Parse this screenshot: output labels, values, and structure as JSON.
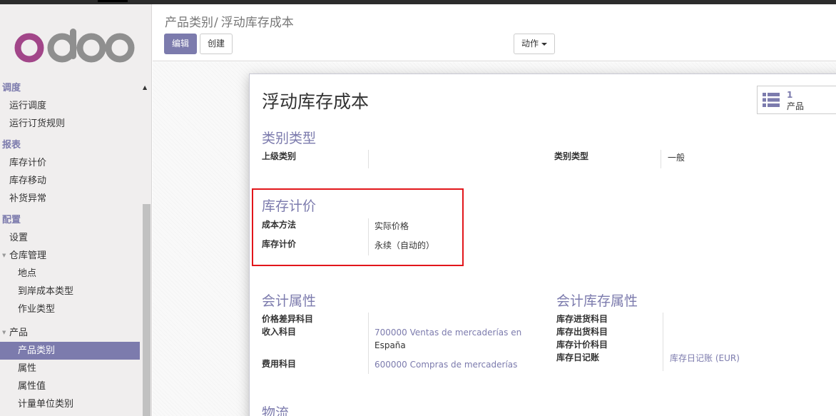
{
  "app": {
    "brand": "odoo"
  },
  "colors": {
    "accent": "#7c7bad",
    "highlight": "#e2161b"
  },
  "sidebar": {
    "sections": {
      "scheduler": "调度",
      "reporting": "报表",
      "config": "配置"
    },
    "items": {
      "run_scheduler": "运行调度",
      "run_reorder": "运行订货规则",
      "stock_valuation": "库存计价",
      "stock_moves": "库存移动",
      "procurement_exceptions": "补货异常",
      "settings": "设置",
      "warehouse_mgmt": "仓库管理",
      "locations": "地点",
      "landed_cost_types": "到岸成本类型",
      "operation_types": "作业类型",
      "products": "产品",
      "product_categories": "产品类别",
      "attributes": "属性",
      "attribute_values": "属性值",
      "uom_categories": "计量单位类别"
    }
  },
  "control_panel": {
    "breadcrumb": {
      "parent": "产品类别",
      "separator": "/",
      "current": "浮动库存成本"
    },
    "edit": "编辑",
    "create": "创建",
    "action": "动作"
  },
  "form": {
    "title": "浮动库存成本",
    "smart_button": {
      "count": "1",
      "label": "产品",
      "icon": "list-icon"
    },
    "category_type_section": {
      "heading": "类别类型",
      "parent_label": "上级类别",
      "parent_value": "",
      "type_label": "类别类型",
      "type_value": "一般"
    },
    "valuation_section": {
      "heading": "库存计价",
      "cost_method_label": "成本方法",
      "cost_method_value": "实际价格",
      "valuation_label": "库存计价",
      "valuation_value": "永续（自动的）"
    },
    "accounting_section": {
      "heading": "会计属性",
      "price_diff_label": "价格差异科目",
      "income_label": "收入科目",
      "income_value_line1": "700000 Ventas de mercaderías en",
      "income_value_line2": "España",
      "expense_label": "费用科目",
      "expense_value": "600000 Compras de mercaderías"
    },
    "stock_accounting_section": {
      "heading": "会计库存属性",
      "input_label": "库存进货科目",
      "output_label": "库存出货科目",
      "valuation_label": "库存计价科目",
      "journal_label": "库存日记账",
      "journal_value": "库存日记账 (EUR)"
    },
    "logistics_section": {
      "heading": "物流"
    }
  }
}
